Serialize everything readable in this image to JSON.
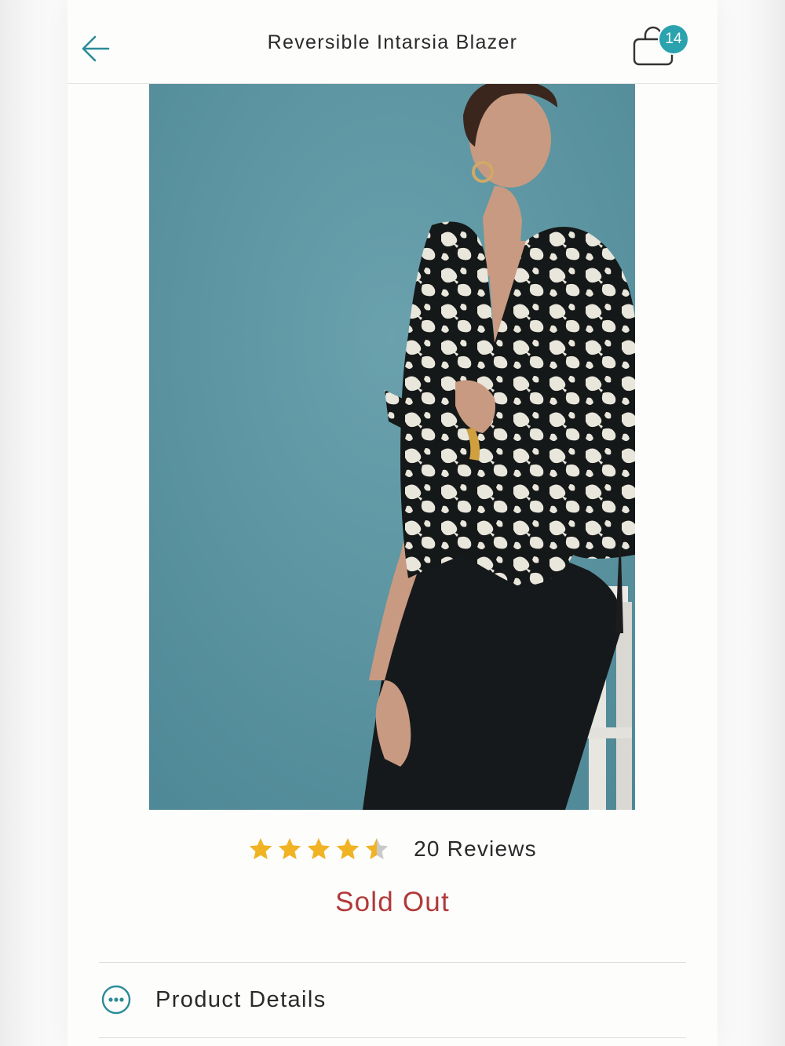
{
  "header": {
    "title": "Reversible Intarsia Blazer",
    "back_icon": "arrow-left-icon",
    "bag_icon": "shopping-bag-icon",
    "bag_count": "14"
  },
  "product": {
    "image_alt": "Model wearing black and white reversible intarsia blazer seated on a white stool against a teal backdrop",
    "rating": 4.5,
    "rating_max": 5,
    "reviews_label": "20 Reviews",
    "stock_status": "Sold Out"
  },
  "details": {
    "label": "Product Details",
    "icon": "more-dots-icon"
  },
  "colors": {
    "accent": "#2aa3ae",
    "star": "#f0b323",
    "sold_out": "#b03a3a",
    "backdrop": "#5e95a2"
  }
}
